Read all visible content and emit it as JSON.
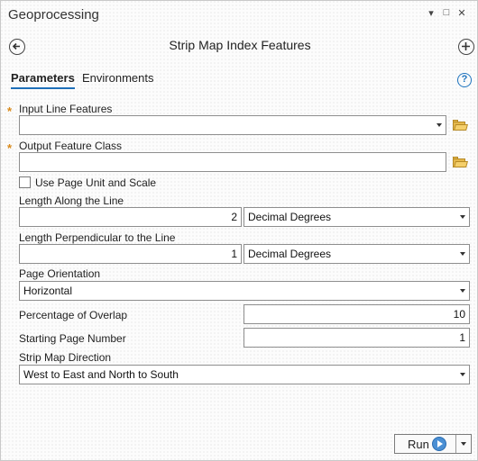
{
  "window": {
    "title": "Geoprocessing",
    "controls": [
      "▾",
      "□",
      "✕"
    ]
  },
  "tool": {
    "title": "Strip Map Index Features",
    "back_icon": "back-arrow-icon",
    "add_icon": "add-icon"
  },
  "tabs": [
    {
      "label": "Parameters",
      "active": true
    },
    {
      "label": "Environments",
      "active": false
    }
  ],
  "help_icon": "?",
  "params": {
    "input_line": {
      "label": "Input Line Features",
      "required": true,
      "value": ""
    },
    "output_class": {
      "label": "Output Feature Class",
      "required": true,
      "value": ""
    },
    "use_page_unit": {
      "label": "Use Page Unit and Scale",
      "checked": false
    },
    "length_along": {
      "label": "Length Along the Line",
      "value": "2",
      "unit": "Decimal Degrees"
    },
    "length_perp": {
      "label": "Length Perpendicular to the Line",
      "value": "1",
      "unit": "Decimal Degrees"
    },
    "orientation": {
      "label": "Page Orientation",
      "value": "Horizontal"
    },
    "overlap": {
      "label": "Percentage of Overlap",
      "value": "10"
    },
    "start_page": {
      "label": "Starting Page Number",
      "value": "1"
    },
    "direction": {
      "label": "Strip Map Direction",
      "value": "West to East and North to South"
    }
  },
  "run_button": {
    "label": "Run"
  },
  "colors": {
    "accent": "#1e6fb8",
    "required": "#d8891a"
  }
}
